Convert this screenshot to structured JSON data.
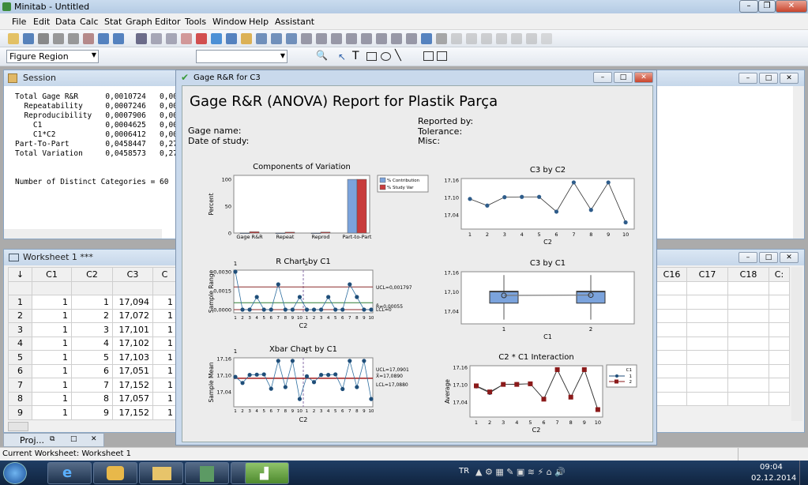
{
  "app": {
    "title": "Minitab - Untitled"
  },
  "menu": [
    "File",
    "Edit",
    "Data",
    "Calc",
    "Stat",
    "Graph",
    "Editor",
    "Tools",
    "Window",
    "Help",
    "Assistant"
  ],
  "toolbar": {
    "region_select": "Figure Region",
    "font_select": ""
  },
  "session": {
    "title": "Session",
    "text": "Total Gage R&R      0,0010724   0,00\n  Repeatability     0,0007246   0,00\n  Reproducibility   0,0007906   0,00\n    C1              0,0004625   0,00\n    C1*C2           0,0006412   0,00\nPart-To-Part        0,0458447   0,27\nTotal Variation     0,0458573   0,27\n\n\nNumber of Distinct Categories = 60"
  },
  "worksheet": {
    "title": "Worksheet 1 ***",
    "arrow": "↓",
    "columns": [
      "C1",
      "C2",
      "C3",
      "C"
    ],
    "right_columns": [
      "C16",
      "C17",
      "C18",
      "C:"
    ],
    "rows": [
      [
        "1",
        "1",
        "1",
        "17,094",
        "1"
      ],
      [
        "2",
        "1",
        "2",
        "17,072",
        "1"
      ],
      [
        "3",
        "1",
        "3",
        "17,101",
        "1"
      ],
      [
        "4",
        "1",
        "4",
        "17,102",
        "1"
      ],
      [
        "5",
        "1",
        "5",
        "17,103",
        "1"
      ],
      [
        "6",
        "1",
        "6",
        "17,051",
        "1"
      ],
      [
        "7",
        "1",
        "7",
        "17,152",
        "1"
      ],
      [
        "8",
        "1",
        "8",
        "17,057",
        "1"
      ],
      [
        "9",
        "1",
        "9",
        "17,152",
        "1"
      ]
    ]
  },
  "project": {
    "label": "Proj..."
  },
  "graph": {
    "window_title": "Gage R&R for C3",
    "report_title": "Gage R&R (ANOVA) Report for Plastik Parça",
    "gage_name": "Gage name:",
    "date_of_study": "Date of study:",
    "reported_by": "Reported by:",
    "tolerance": "Tolerance:",
    "misc": "Misc:"
  },
  "chart_data": [
    {
      "type": "bar",
      "title": "Components of Variation",
      "ylabel": "Percent",
      "categories": [
        "Gage R&R",
        "Repeat",
        "Reprod",
        "Part-to-Part"
      ],
      "ylim": [
        0,
        100
      ],
      "yticks": [
        "0",
        "50",
        "100"
      ],
      "series": [
        {
          "name": "% Contribution",
          "color": "#7ba3dc",
          "values": [
            0.1,
            0.05,
            0.05,
            99.9
          ]
        },
        {
          "name": "% Study Var",
          "color": "#c83c3c",
          "values": [
            2.3,
            1.6,
            1.7,
            99.97
          ]
        }
      ],
      "legend": "right"
    },
    {
      "type": "line",
      "title": "C3 by C2",
      "xlabel": "C2",
      "x": [
        1,
        2,
        3,
        4,
        5,
        6,
        7,
        8,
        9,
        10
      ],
      "values": [
        17.095,
        17.072,
        17.101,
        17.102,
        17.102,
        17.051,
        17.152,
        17.057,
        17.152,
        17.014
      ],
      "ylim": [
        17.01,
        17.165
      ],
      "yticks": [
        "17,04",
        "17,10",
        "17,16"
      ]
    },
    {
      "type": "line",
      "title": "R Chart by C1",
      "xlabel": "C2",
      "ylabel": "Sample Range",
      "panels": [
        "1",
        "2"
      ],
      "x": [
        1,
        2,
        3,
        4,
        5,
        6,
        7,
        8,
        9,
        10,
        1,
        2,
        3,
        4,
        5,
        6,
        7,
        8,
        9,
        10
      ],
      "values": [
        0.003,
        0,
        0,
        0.001,
        0,
        0,
        0.002,
        0,
        0,
        0.001,
        0,
        0,
        0,
        0.001,
        0,
        0,
        0.002,
        0.001,
        0,
        0
      ],
      "ylim": [
        0,
        0.0031
      ],
      "yticks": [
        "0,0000",
        "0,0015",
        "0,0030"
      ],
      "limits": {
        "ucl": 0.001797,
        "center": 0.00055,
        "lcl": 0
      },
      "limit_labels": [
        "UCL=0,001797",
        "R̄=0,00055",
        "LCL=0"
      ]
    },
    {
      "type": "line",
      "title": "Xbar Chart by C1",
      "xlabel": "C2",
      "ylabel": "Sample Mean",
      "panels": [
        "1",
        "2"
      ],
      "x": [
        1,
        2,
        3,
        4,
        5,
        6,
        7,
        8,
        9,
        10,
        1,
        2,
        3,
        4,
        5,
        6,
        7,
        8,
        9,
        10
      ],
      "values": [
        17.094,
        17.072,
        17.101,
        17.102,
        17.103,
        17.051,
        17.152,
        17.057,
        17.152,
        17.014,
        17.096,
        17.075,
        17.101,
        17.101,
        17.103,
        17.05,
        17.152,
        17.057,
        17.152,
        17.014
      ],
      "ylim": [
        17.01,
        17.165
      ],
      "yticks": [
        "17,04",
        "17,10",
        "17,16"
      ],
      "limits": {
        "ucl": 17.0901,
        "center": 17.089,
        "lcl": 17.088
      },
      "limit_labels": [
        "UCL=17,0901",
        "X̄=17,0890",
        "LCL=17,0880"
      ]
    },
    {
      "type": "box",
      "title": "C3 by C1",
      "xlabel": "C1",
      "categories": [
        "1",
        "2"
      ],
      "ylim": [
        17.0,
        17.165
      ],
      "yticks": [
        "17,04",
        "17,10",
        "17,16"
      ],
      "boxes": [
        {
          "min": 17.014,
          "q1": 17.065,
          "median": 17.1,
          "q3": 17.102,
          "max": 17.152,
          "mean": 17.089
        },
        {
          "min": 17.014,
          "q1": 17.065,
          "median": 17.1,
          "q3": 17.102,
          "max": 17.152,
          "mean": 17.09
        }
      ]
    },
    {
      "type": "line",
      "title": "C2 * C1 Interaction",
      "xlabel": "C2",
      "ylabel": "Average",
      "x": [
        1,
        2,
        3,
        4,
        5,
        6,
        7,
        8,
        9,
        10
      ],
      "ylim": [
        17.01,
        17.165
      ],
      "yticks": [
        "17,04",
        "17,10",
        "17,16"
      ],
      "legend_title": "C1",
      "series": [
        {
          "name": "1",
          "color": "#1f4e79",
          "values": [
            17.094,
            17.072,
            17.101,
            17.102,
            17.103,
            17.051,
            17.152,
            17.057,
            17.152,
            17.014
          ]
        },
        {
          "name": "2",
          "color": "#8b1a1a",
          "values": [
            17.096,
            17.075,
            17.101,
            17.101,
            17.103,
            17.05,
            17.152,
            17.057,
            17.152,
            17.014
          ]
        }
      ]
    }
  ],
  "statusbar": {
    "text": "Current Worksheet: Worksheet 1"
  },
  "taskbar": {
    "lang": "TR",
    "time": "09:04",
    "date": "02.12.2014"
  }
}
